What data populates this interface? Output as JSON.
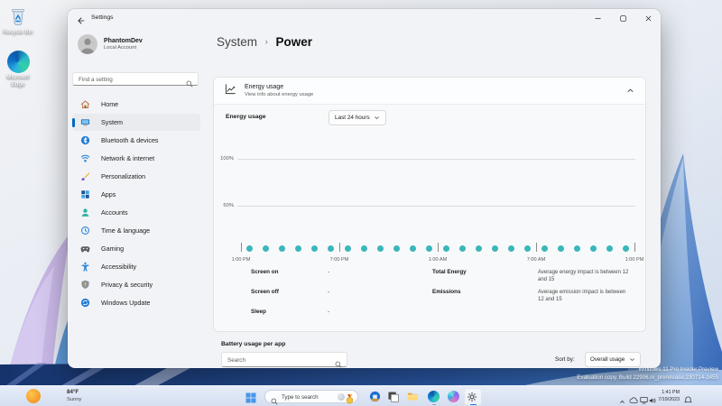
{
  "desktop": {
    "icons": [
      {
        "id": "recycle-bin",
        "label": "Recycle Bin"
      },
      {
        "id": "microsoft-edge",
        "label": "Microsoft Edge"
      }
    ],
    "watermark_line1": "Windows 11 Pro Insider Preview",
    "watermark_line2": "Evaluation copy. Build 22906.ni_prerelease.230714-1455"
  },
  "window": {
    "title": "Settings",
    "account": {
      "name": "PhantomDev",
      "type": "Local Account"
    },
    "sidebar_search_placeholder": "Find a setting",
    "nav": [
      {
        "id": "home",
        "label": "Home",
        "selected": false
      },
      {
        "id": "system",
        "label": "System",
        "selected": true
      },
      {
        "id": "bluetooth",
        "label": "Bluetooth & devices",
        "selected": false
      },
      {
        "id": "network",
        "label": "Network & internet",
        "selected": false
      },
      {
        "id": "personalization",
        "label": "Personalization",
        "selected": false
      },
      {
        "id": "apps",
        "label": "Apps",
        "selected": false
      },
      {
        "id": "accounts",
        "label": "Accounts",
        "selected": false
      },
      {
        "id": "time",
        "label": "Time & language",
        "selected": false
      },
      {
        "id": "gaming",
        "label": "Gaming",
        "selected": false
      },
      {
        "id": "accessibility",
        "label": "Accessibility",
        "selected": false
      },
      {
        "id": "privacy",
        "label": "Privacy & security",
        "selected": false
      },
      {
        "id": "update",
        "label": "Windows Update",
        "selected": false
      }
    ],
    "breadcrumb": {
      "parent": "System",
      "separator": "›",
      "current": "Power"
    },
    "energy_card": {
      "title": "Energy usage",
      "subtitle": "View info about energy usage",
      "row_label": "Energy usage",
      "range_value": "Last 24 hours",
      "stats_left": [
        {
          "label": "Screen on",
          "value": "-"
        },
        {
          "label": "Screen off",
          "value": "-"
        },
        {
          "label": "Sleep",
          "value": "-"
        }
      ],
      "stats_right": [
        {
          "label": "Total Energy",
          "value": "Average energy impact is between 12 and 15"
        },
        {
          "label": "Emissions",
          "value": "Average emission impact is between 12 and 15"
        }
      ]
    },
    "battery_section": {
      "title": "Battery usage per app",
      "search_placeholder": "Search",
      "sort_label": "Sort by:",
      "sort_value": "Overall usage"
    }
  },
  "chart_data": {
    "type": "scatter",
    "title": "Energy usage",
    "x_tick_labels": [
      "1:00 PM",
      "7:00 PM",
      "1:00 AM",
      "7:00 AM",
      "1:00 PM"
    ],
    "y_tick_labels": [
      "100%",
      "50%"
    ],
    "ylim": [
      0,
      100
    ],
    "x_span_hours": 24,
    "values": [
      8,
      8,
      8,
      8,
      8,
      8,
      8,
      8,
      8,
      8,
      8,
      8,
      8,
      8,
      8,
      8,
      8,
      8,
      8,
      8,
      8,
      8,
      8,
      8
    ],
    "point_color": "#3bb6b9",
    "grid": true,
    "legend": false
  },
  "taskbar": {
    "weather": {
      "temp": "84°F",
      "condition": "Sunny"
    },
    "search_placeholder": "Type to search",
    "apps": [
      {
        "id": "ms-store"
      },
      {
        "id": "task-view"
      },
      {
        "id": "file-explorer"
      },
      {
        "id": "edge",
        "running": true
      },
      {
        "id": "copilot"
      },
      {
        "id": "settings",
        "active": true
      }
    ],
    "clock": {
      "time": "1:41 PM",
      "date": "7/19/2023"
    }
  }
}
